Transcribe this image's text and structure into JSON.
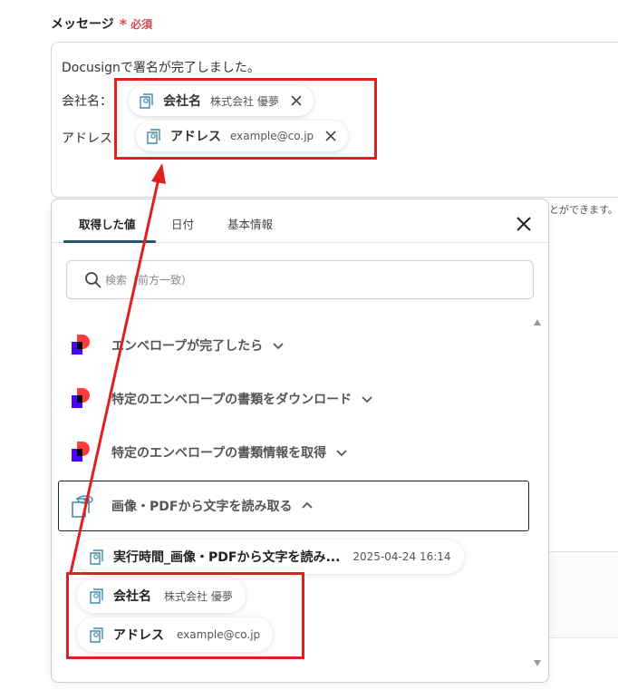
{
  "field": {
    "label": "メッセージ",
    "required_mark": "*",
    "required_text": "必須"
  },
  "message": {
    "line1": "Docusignで署名が完了しました。",
    "label_company": "会社名：",
    "label_address": "アドレス"
  },
  "message_chips": [
    {
      "name": "会社名",
      "value": "株式会社 優夢"
    },
    {
      "name": "アドレス",
      "value": "example@co.jp"
    }
  ],
  "background_hint": "とができます。",
  "popup": {
    "tabs": [
      {
        "label": "取得した値"
      },
      {
        "label": "日付"
      },
      {
        "label": "基本情報"
      }
    ],
    "search_placeholder": "検索（前方一致）",
    "sections": [
      {
        "label": "エンベロープが完了したら"
      },
      {
        "label": "特定のエンベロープの書類をダウンロード"
      },
      {
        "label": "特定のエンベロープの書類情報を取得"
      },
      {
        "label": "画像・PDFから文字を読み取る"
      }
    ],
    "items": [
      {
        "name": "実行時間_画像・PDFから文字を読み...",
        "value": "2025-04-24 16:14"
      },
      {
        "name": "会社名",
        "value": "株式会社 優夢"
      },
      {
        "name": "アドレス",
        "value": "example@co.jp"
      }
    ]
  },
  "colors": {
    "required": "#e0464b",
    "annotation_red": "#e02020",
    "tab_underline": "#1e5a6b",
    "docusign_red": "#ff3b3b",
    "docusign_purple": "#4c00ff"
  },
  "icons": {
    "ocr_item": "ocr-doc-icon",
    "close": "close-icon",
    "search": "search-icon",
    "chevron": "chevron-down-icon",
    "docusign": "docusign-logo-icon"
  }
}
